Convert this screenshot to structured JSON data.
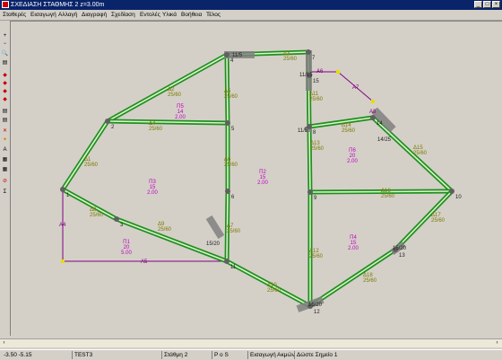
{
  "window": {
    "title": "ΣΧΕΔΙΑΣΗ ΣΤΑΘΜΗΣ 2   z=3.00m",
    "btn_min": "_",
    "btn_max": "□",
    "btn_close": "×"
  },
  "menu": [
    "Σταθερές",
    "Εισαγωγή",
    "Αλλαγή",
    "Διαγραφή",
    "Σχεδίαση",
    "Εντολές",
    "Υλικά",
    "Βοήθεια",
    "Τέλος"
  ],
  "toolbar": {
    "icons": [
      "+",
      "−",
      "🔍",
      "▤",
      "◆",
      "◆",
      "◆",
      "◆",
      "▤",
      "▤",
      "✕",
      "✦",
      "A",
      "▦",
      "▦",
      "⊘",
      "Σ"
    ]
  },
  "drawing": {
    "colors": {
      "beam_outer": "#1f8f1f",
      "beam_inner": "#d9f2c8",
      "column": "#808080",
      "node": "#606060",
      "beam_label": "#7a7a00",
      "slab_label": "#c000c0",
      "purple_line": "#800080",
      "yellow_mark": "#e0e000"
    },
    "nodes": [
      {
        "id": "n1",
        "label": "1"
      },
      {
        "id": "n2",
        "label": "2"
      },
      {
        "id": "n3",
        "label": "3"
      },
      {
        "id": "n4",
        "label": "4"
      },
      {
        "id": "n5",
        "label": "5"
      },
      {
        "id": "n6",
        "label": "6"
      },
      {
        "id": "n7",
        "label": "7"
      },
      {
        "id": "n8",
        "label": "8"
      },
      {
        "id": "n9",
        "label": "9"
      },
      {
        "id": "n10",
        "label": "10"
      },
      {
        "id": "n11",
        "label": "11"
      },
      {
        "id": "n12",
        "label": "12"
      },
      {
        "id": "n13",
        "label": "13"
      },
      {
        "id": "n14",
        "label": "14"
      },
      {
        "id": "n15",
        "label": "15"
      }
    ],
    "beam_labels": [
      {
        "name": "Δ1",
        "sec": "25/60"
      },
      {
        "name": "Δ2",
        "sec": "25/60"
      },
      {
        "name": "Δ3",
        "sec": "25/60"
      },
      {
        "name": "Δ4",
        "sec": "25/60"
      },
      {
        "name": "Δ5",
        "sec": "25/60"
      },
      {
        "name": "Δ6",
        "sec": "25/60"
      },
      {
        "name": "Δ7",
        "sec": "25/60"
      },
      {
        "name": "Δ8",
        "sec": "25/60"
      },
      {
        "name": "Δ9",
        "sec": "25/60"
      },
      {
        "name": "Δ10",
        "sec": "25/60"
      },
      {
        "name": "Δ11",
        "sec": "25/60"
      },
      {
        "name": "Δ12",
        "sec": "25/60"
      },
      {
        "name": "Δ13",
        "sec": "25/60"
      },
      {
        "name": "Δ14",
        "sec": "25/60"
      },
      {
        "name": "Δ15",
        "sec": "25/60"
      },
      {
        "name": "Δ16",
        "sec": "25/60"
      },
      {
        "name": "Δ17",
        "sec": "25/60"
      },
      {
        "name": "Δ18",
        "sec": "25/60"
      },
      {
        "name": "Δ19",
        "sec": "25/60"
      },
      {
        "name": "Δ20",
        "sec": "25/60"
      }
    ],
    "slabs": [
      {
        "name": "Π1",
        "thick": "20",
        "load": "5.00"
      },
      {
        "name": "Π2",
        "thick": "15",
        "load": "2.00"
      },
      {
        "name": "Π3",
        "thick": "15",
        "load": "2.00"
      },
      {
        "name": "Π4",
        "thick": "15",
        "load": "2.00"
      },
      {
        "name": "Π5",
        "thick": "14",
        "load": "2.00"
      },
      {
        "name": "Π6",
        "thick": "20",
        "load": "2.00"
      }
    ],
    "column_labels": [
      "11/5",
      "11/15",
      "11/5",
      "15/20",
      "16/20",
      "14/25",
      "15/20"
    ],
    "purple_labels": [
      "A4",
      "A5",
      "A6",
      "A7",
      "A8"
    ]
  },
  "statusbar": {
    "coords": "-3.50  -5.15",
    "project": "TEST3",
    "level": "Στάθμη 2",
    "mode": "P o S",
    "command": "Εισαγωγή Ακμών",
    "prompt": "Δώστε Σημείο 1"
  }
}
